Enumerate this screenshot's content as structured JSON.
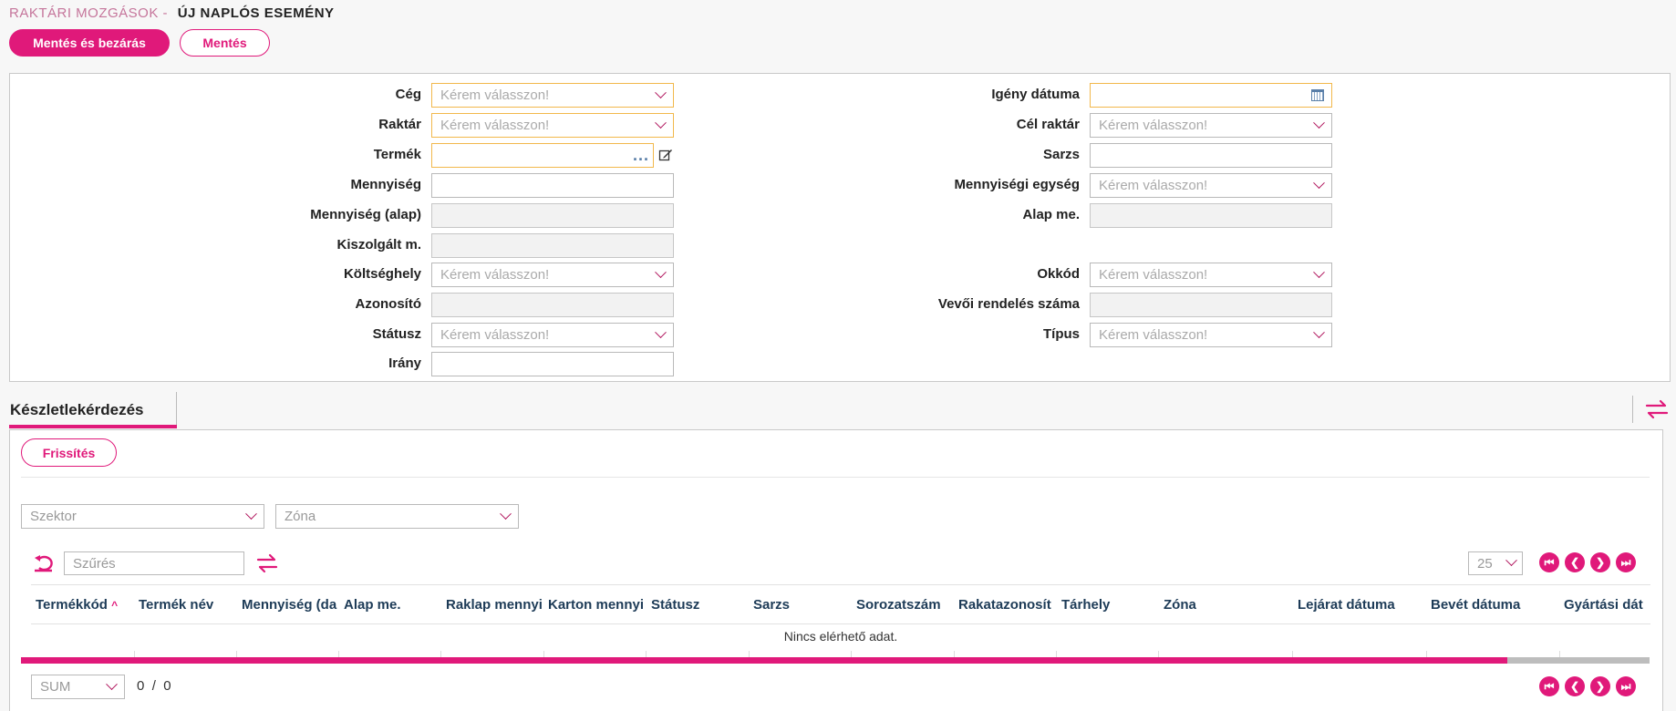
{
  "header": {
    "breadcrumb": "RAKTÁRI MOZGÁSOK -",
    "title": "ÚJ NAPLÓS ESEMÉNY"
  },
  "toolbar": {
    "save_close_label": "Mentés és bezárás",
    "save_label": "Mentés"
  },
  "form": {
    "left": [
      {
        "label": "Cég",
        "value": "Kérem válasszon!",
        "kind": "select",
        "required": true
      },
      {
        "label": "Raktár",
        "value": "Kérem válasszon!",
        "kind": "select",
        "required": true
      },
      {
        "label": "Termék",
        "value": "",
        "kind": "lookup",
        "required": true
      },
      {
        "label": "Mennyiség",
        "value": "",
        "kind": "text"
      },
      {
        "label": "Mennyiség (alap)",
        "value": "",
        "kind": "disabled"
      },
      {
        "label": "Kiszolgált m.",
        "value": "",
        "kind": "disabled"
      },
      {
        "label": "Költséghely",
        "value": "Kérem válasszon!",
        "kind": "select"
      },
      {
        "label": "Azonosító",
        "value": "",
        "kind": "disabled"
      },
      {
        "label": "Státusz",
        "value": "Kérem válasszon!",
        "kind": "select"
      },
      {
        "label": "Irány",
        "value": "",
        "kind": "text"
      }
    ],
    "right": [
      {
        "label": "Igény dátuma",
        "value": "",
        "kind": "date",
        "required": true
      },
      {
        "label": "Cél raktár",
        "value": "Kérem válasszon!",
        "kind": "select"
      },
      {
        "label": "Sarzs",
        "value": "",
        "kind": "text"
      },
      {
        "label": "Mennyiségi egység",
        "value": "Kérem válasszon!",
        "kind": "select"
      },
      {
        "label": "Alap me.",
        "value": "",
        "kind": "disabled"
      },
      {
        "label": "Okkód",
        "value": "Kérem válasszon!",
        "kind": "select"
      },
      {
        "label": "Vevői rendelés száma",
        "value": "",
        "kind": "disabled"
      },
      {
        "label": "Típus",
        "value": "Kérem válasszon!",
        "kind": "select"
      }
    ]
  },
  "tabs": [
    {
      "label": "Készletlekérdezés",
      "active": true
    }
  ],
  "stock": {
    "refresh_label": "Frissítés",
    "sector_placeholder": "Szektor",
    "zone_placeholder": "Zóna",
    "filter_placeholder": "Szűrés",
    "page_size": "25",
    "columns": [
      "Termékkód",
      "Termék név",
      "Mennyiség (da",
      "Alap me.",
      "Raklap mennyi",
      "Karton mennyi",
      "Státusz",
      "Sarzs",
      "Sorozatszám",
      "Rakatazonosít",
      "Tárhely",
      "Zóna",
      "Lejárat dátuma",
      "Bevét dátuma",
      "Gyártási dát"
    ],
    "sorted_column": "Termékkód",
    "no_data": "Nincs elérhető adat.",
    "aggregate": "SUM",
    "count_current": "0",
    "count_sep": "/",
    "count_total": "0"
  },
  "colors": {
    "accent": "#e0197a",
    "required_border": "#f2b84b",
    "header_text": "#1d3b57"
  }
}
